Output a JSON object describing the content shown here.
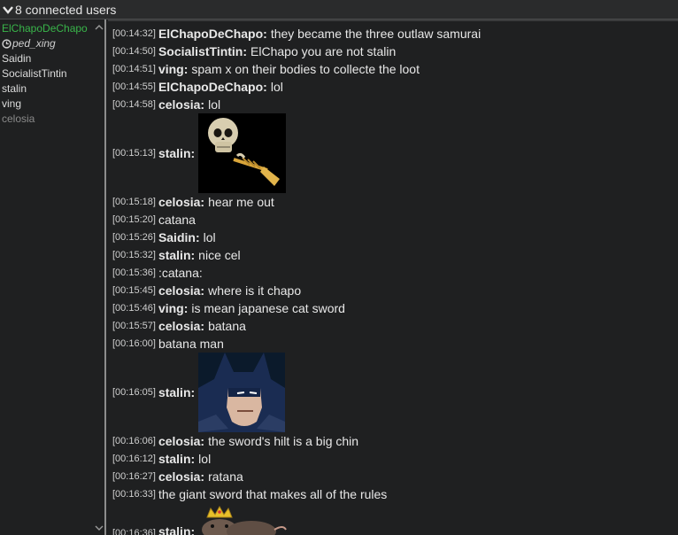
{
  "header": {
    "title": "8 connected users",
    "chevron_icon": "chevron-down-icon"
  },
  "users": {
    "list": [
      {
        "name": "ElChapoDeChapo",
        "state": "active"
      },
      {
        "name": "ped_xing",
        "state": "away"
      },
      {
        "name": "Saidin",
        "state": "normal"
      },
      {
        "name": "SocialistTintin",
        "state": "normal"
      },
      {
        "name": "stalin",
        "state": "normal"
      },
      {
        "name": "ving",
        "state": "normal"
      },
      {
        "name": "celosia",
        "state": "idle"
      }
    ]
  },
  "messages": [
    {
      "ts": "[00:14:32]",
      "nick": "ElChapoDeChapo:",
      "text": "they became the three outlaw samurai"
    },
    {
      "ts": "[00:14:50]",
      "nick": "SocialistTintin:",
      "text": "ElChapo you are not stalin"
    },
    {
      "ts": "[00:14:51]",
      "nick": "ving:",
      "text": "spam x on their bodies to collecte the loot"
    },
    {
      "ts": "[00:14:55]",
      "nick": "ElChapoDeChapo:",
      "text": "lol"
    },
    {
      "ts": "[00:14:58]",
      "nick": "celosia:",
      "text": "lol"
    },
    {
      "ts": "[00:15:13]",
      "nick": "stalin:",
      "text": "",
      "image": "doot-skull-trumpet"
    },
    {
      "ts": "[00:15:18]",
      "nick": "celosia:",
      "text": "hear me out"
    },
    {
      "ts": "[00:15:20]",
      "nick": "",
      "text": "catana"
    },
    {
      "ts": "[00:15:26]",
      "nick": "Saidin:",
      "text": "lol"
    },
    {
      "ts": "[00:15:32]",
      "nick": "stalin:",
      "text": "nice cel"
    },
    {
      "ts": "[00:15:36]",
      "nick": "",
      "text": ":catana:"
    },
    {
      "ts": "[00:15:45]",
      "nick": "celosia:",
      "text": "where is it chapo"
    },
    {
      "ts": "[00:15:46]",
      "nick": "ving:",
      "text": "is mean japanese cat sword"
    },
    {
      "ts": "[00:15:57]",
      "nick": "celosia:",
      "text": "batana"
    },
    {
      "ts": "[00:16:00]",
      "nick": "",
      "text": "batana man"
    },
    {
      "ts": "[00:16:05]",
      "nick": "stalin:",
      "text": "",
      "image": "chin-batman"
    },
    {
      "ts": "[00:16:06]",
      "nick": "celosia:",
      "text": "the sword's hilt is a big chin"
    },
    {
      "ts": "[00:16:12]",
      "nick": "stalin:",
      "text": "lol"
    },
    {
      "ts": "[00:16:27]",
      "nick": "celosia:",
      "text": "ratana"
    },
    {
      "ts": "[00:16:33]",
      "nick": "",
      "text": "the giant sword that makes all of the rules"
    },
    {
      "ts": "[00:16:36]",
      "nick": "stalin:",
      "text": "",
      "image": "crowned-rat"
    }
  ],
  "colors": {
    "background": "#1f2021",
    "active_user": "#39b54a",
    "idle_user": "#8a8a8a",
    "text": "#e8e8e8"
  }
}
